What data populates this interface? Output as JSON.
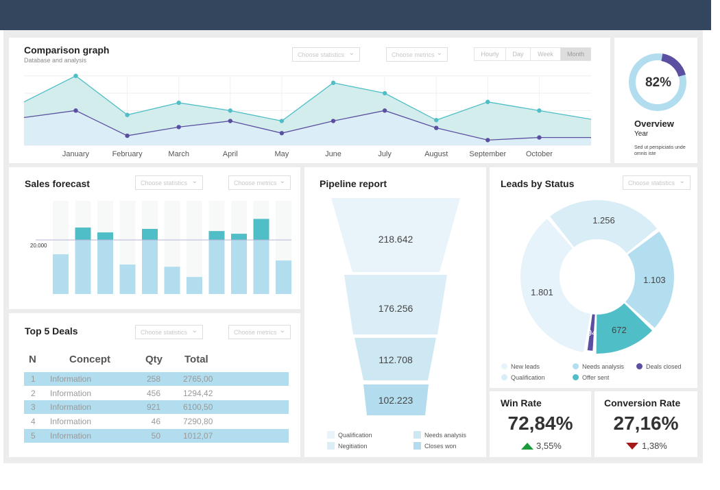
{
  "colors": {
    "topbar": "#34465e",
    "teal": "#4fbec6",
    "purple": "#5a4fa0",
    "light_blue": "#b1ddef",
    "up": "#1a9a3a",
    "down": "#a31818"
  },
  "comparison": {
    "title": "Comparison graph",
    "subtitle": "Database and analysis",
    "statistics_dropdown": "Choose statistics",
    "metrics_dropdown": "Choose metrics",
    "periods": [
      {
        "label": "Hourly",
        "active": false
      },
      {
        "label": "Day",
        "active": false
      },
      {
        "label": "Week",
        "active": false
      },
      {
        "label": "Month",
        "active": true
      }
    ]
  },
  "chart_data": [
    {
      "type": "area",
      "categories": [
        "January",
        "February",
        "March",
        "April",
        "May",
        "June",
        "July",
        "August",
        "September",
        "October"
      ],
      "ylim": [
        0,
        4
      ],
      "grid": true,
      "series": [
        {
          "color": "#4fbec6",
          "lead": 2.5,
          "values": [
            4.0,
            1.75,
            2.45,
            2.0,
            1.4,
            3.6,
            3.0,
            1.45,
            2.5,
            2.0
          ],
          "trail": 1.5
        },
        {
          "color": "#5a4fa0",
          "lead": 1.6,
          "values": [
            2.0,
            0.55,
            1.05,
            1.4,
            0.7,
            1.4,
            2.0,
            1.0,
            0.3,
            0.45
          ],
          "trail": 0.45
        }
      ]
    },
    {
      "type": "bar",
      "title": "Sales forecast",
      "reference_line": {
        "value": 20000,
        "label": "20.000"
      },
      "ylim": [
        0,
        34500
      ],
      "values": [
        14700,
        24600,
        22800,
        10900,
        24100,
        10100,
        6300,
        23300,
        22300,
        27800,
        12400
      ]
    },
    {
      "type": "pie",
      "title": "Leads by Status",
      "slices": [
        {
          "label": "New leads",
          "value": 1801,
          "display": "1.801",
          "color": "#e6f3fa"
        },
        {
          "label": "Qualification",
          "value": 1256,
          "display": "1.256",
          "color": "#d9edf7"
        },
        {
          "label": "Needs analysis",
          "value": 1103,
          "display": "1.103",
          "color": "#b3def0"
        },
        {
          "label": "Offer sent",
          "value": 672,
          "display": "672",
          "color": "#4fbec6"
        },
        {
          "label": "Deals closed",
          "value": 94,
          "display": "94",
          "color": "#5a4fa0"
        }
      ]
    }
  ],
  "overview": {
    "percent_label": "82%",
    "percent": 82,
    "title": "Overview",
    "period": "Year",
    "text": "Sed ut perspiciatis unde omnis iste"
  },
  "sales": {
    "title": "Sales forecast",
    "statistics_dropdown": "Choose statistics",
    "metrics_dropdown": "Choose metrics"
  },
  "deals": {
    "title": "Top 5 Deals",
    "statistics_dropdown": "Choose statistics",
    "metrics_dropdown": "Choose metrics",
    "columns": [
      "N",
      "Concept",
      "Qty",
      "Total"
    ],
    "rows": [
      [
        "1",
        "Information",
        "258",
        "2765,00"
      ],
      [
        "2",
        "Information",
        "456",
        "1294,42"
      ],
      [
        "3",
        "Information",
        "921",
        "6100,50"
      ],
      [
        "4",
        "Information",
        "46",
        "7290,80"
      ],
      [
        "5",
        "Information",
        "50",
        "1012,07"
      ]
    ]
  },
  "pipeline": {
    "title": "Pipeline report",
    "stages": [
      "218.642",
      "176.256",
      "112.708",
      "102.223"
    ],
    "legend": [
      {
        "label": "Qualification",
        "color": "#e8f4fa"
      },
      {
        "label": "Needs analysis",
        "color": "#cde8f3"
      },
      {
        "label": "Negitiation",
        "color": "#dbeef7"
      },
      {
        "label": "Closes won",
        "color": "#b3ddee"
      }
    ]
  },
  "leads": {
    "title": "Leads by Status",
    "statistics_dropdown": "Choose statistics"
  },
  "win_rate": {
    "title": "Win Rate",
    "value": "72,84%",
    "delta": "3,55%",
    "direction": "up"
  },
  "conversion_rate": {
    "title": "Conversion Rate",
    "value": "27,16%",
    "delta": "1,38%",
    "direction": "down"
  }
}
